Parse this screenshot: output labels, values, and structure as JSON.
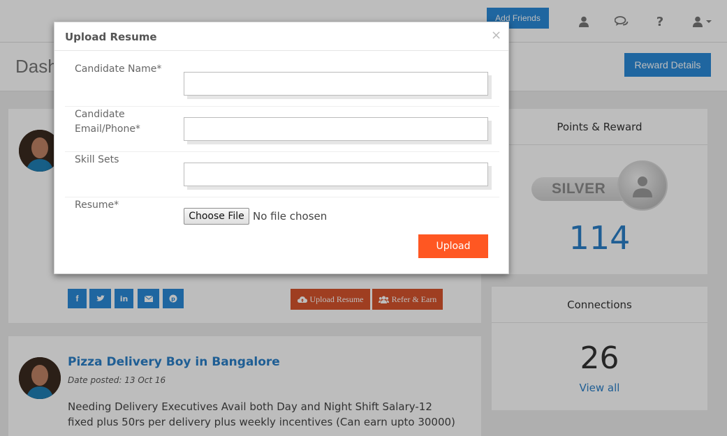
{
  "navbar": {
    "add_friends_label": "Add Friends",
    "icons": [
      "user-icon",
      "chat-icon",
      "help-icon",
      "account-menu-icon"
    ]
  },
  "header": {
    "page_title": "Dash",
    "reward_details_label": "Reward Details"
  },
  "profile_card": {
    "social_icons": [
      "facebook-icon",
      "twitter-icon",
      "linkedin-icon",
      "email-icon",
      "pinterest-icon"
    ],
    "upload_resume_label": "Upload Resume",
    "refer_earn_label": "Refer & Earn"
  },
  "post": {
    "title": "Pizza Delivery Boy in Bangalore",
    "date_posted": "Date posted: 13 Oct 16",
    "body_line1": "Needing Delivery Executives Avail both Day and Night Shift Salary-12",
    "body_line2": "fixed plus 50rs per delivery plus weekly incentives (Can earn upto 30000)"
  },
  "points_reward": {
    "title": "Points & Reward",
    "badge_label": "SILVER",
    "points": "114"
  },
  "connections": {
    "title": "Connections",
    "count": "26",
    "view_all_label": "View all"
  },
  "modal": {
    "title": "Upload Resume",
    "close_symbol": "×",
    "fields": {
      "name_label": "Candidate Name*",
      "name_value": "",
      "contact_label_line1": "Candidate",
      "contact_label_line2": "Email/Phone*",
      "contact_value": "",
      "skills_label": "Skill Sets",
      "skills_value": "",
      "resume_label": "Resume*"
    },
    "choose_file_label": "Choose File",
    "file_status": "No file chosen",
    "upload_label": "Upload"
  },
  "colors": {
    "primary_blue": "#2a8ad8",
    "link_blue": "#2a7fc8",
    "upload_orange": "#ff5722",
    "action_orange": "#d7542d"
  }
}
